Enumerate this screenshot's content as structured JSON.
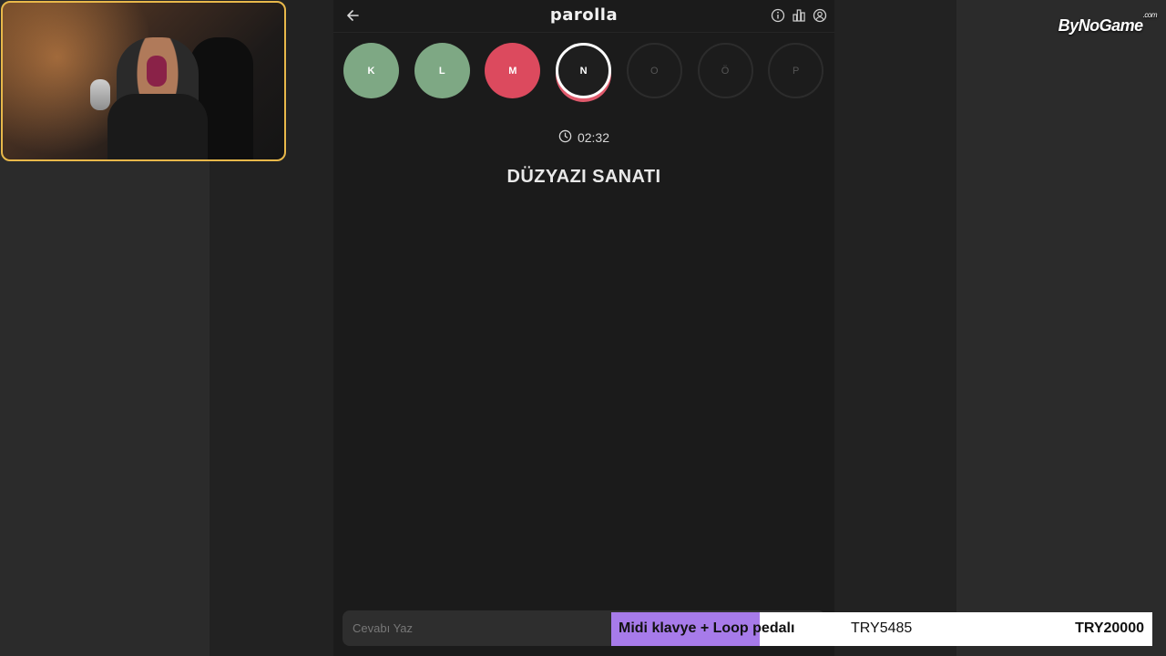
{
  "app": {
    "title": "parolla",
    "timer": "02:32",
    "question": "DÜZYAZI SANATI",
    "answer_placeholder": "Cevabı Yaz"
  },
  "letters": [
    {
      "char": "K",
      "state": "correct"
    },
    {
      "char": "L",
      "state": "correct"
    },
    {
      "char": "M",
      "state": "wrong"
    },
    {
      "char": "N",
      "state": "current"
    },
    {
      "char": "O",
      "state": "pending"
    },
    {
      "char": "Ö",
      "state": "pending"
    },
    {
      "char": "P",
      "state": "pending"
    }
  ],
  "icons": {
    "back": "arrow-left-icon",
    "info": "info-icon",
    "stats": "bar-chart-icon",
    "profile": "user-circle-icon",
    "timer": "clock-icon"
  },
  "overlay": {
    "brand": "ByNoGame",
    "brand_suffix": ".com",
    "donation_goal": {
      "title": "Midi klavye + Loop pedalı",
      "current": "TRY5485",
      "target": "TRY20000",
      "progress_fraction": 0.274
    }
  },
  "colors": {
    "correct": "#7ea884",
    "wrong": "#dc4a5e",
    "progress": "#a77bea"
  }
}
